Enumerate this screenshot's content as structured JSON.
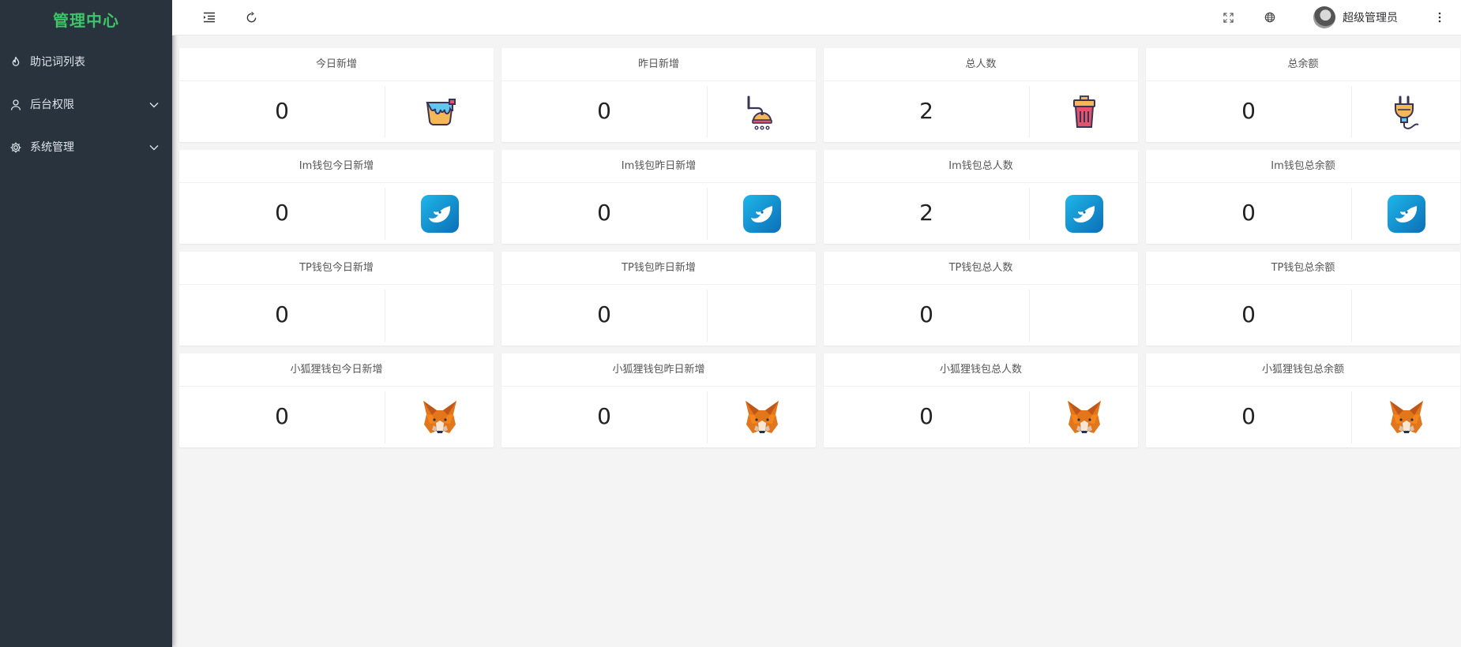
{
  "sidebar": {
    "brand": "管理中心",
    "items": [
      {
        "label": "助记词列表",
        "icon": "fire-icon",
        "has_children": false
      },
      {
        "label": "后台权限",
        "icon": "user-icon",
        "has_children": true
      },
      {
        "label": "系统管理",
        "icon": "gear-icon",
        "has_children": true
      }
    ]
  },
  "header": {
    "user_name": "超级管理员",
    "icons": [
      "menu-fold-icon",
      "refresh-icon",
      "fullscreen-icon",
      "globe-icon",
      "more-vertical-icon"
    ]
  },
  "cards": [
    {
      "title": "今日新增",
      "value": "0",
      "icon": "paint-bucket-icon"
    },
    {
      "title": "昨日新增",
      "value": "0",
      "icon": "shower-icon"
    },
    {
      "title": "总人数",
      "value": "2",
      "icon": "trash-bin-icon"
    },
    {
      "title": "总余额",
      "value": "0",
      "icon": "plug-icon"
    },
    {
      "title": "Im钱包今日新增",
      "value": "0",
      "icon": "imtoken-icon"
    },
    {
      "title": "Im钱包昨日新增",
      "value": "0",
      "icon": "imtoken-icon"
    },
    {
      "title": "Im钱包总人数",
      "value": "2",
      "icon": "imtoken-icon"
    },
    {
      "title": "Im钱包总余额",
      "value": "0",
      "icon": "imtoken-icon"
    },
    {
      "title": "TP钱包今日新增",
      "value": "0",
      "icon": ""
    },
    {
      "title": "TP钱包昨日新增",
      "value": "0",
      "icon": ""
    },
    {
      "title": "TP钱包总人数",
      "value": "0",
      "icon": ""
    },
    {
      "title": "TP钱包总余额",
      "value": "0",
      "icon": ""
    },
    {
      "title": "小狐狸钱包今日新增",
      "value": "0",
      "icon": "metamask-fox-icon"
    },
    {
      "title": "小狐狸钱包昨日新增",
      "value": "0",
      "icon": "metamask-fox-icon"
    },
    {
      "title": "小狐狸钱包总人数",
      "value": "0",
      "icon": "metamask-fox-icon"
    },
    {
      "title": "小狐狸钱包总余额",
      "value": "0",
      "icon": "metamask-fox-icon"
    }
  ],
  "colors": {
    "sidebar_bg": "#28333e",
    "brand": "#3fc46a",
    "page_bg": "#f4f4f4",
    "imtoken": "#1a8fd6"
  }
}
